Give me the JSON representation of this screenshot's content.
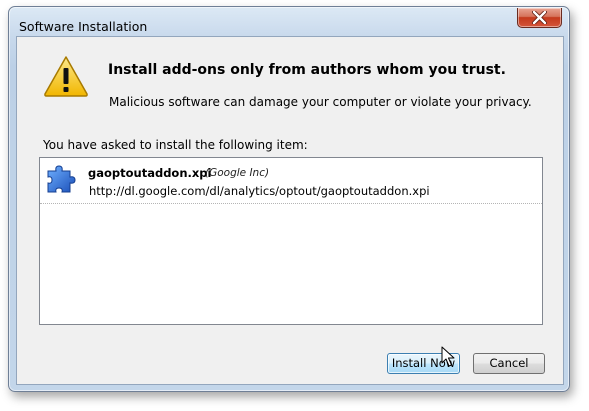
{
  "window": {
    "title": "Software Installation"
  },
  "warning": {
    "heading": "Install add-ons only from authors whom you trust.",
    "subtext": "Malicious software can damage your computer or violate your privacy."
  },
  "items_caption": "You have asked to install the following item:",
  "items": [
    {
      "name": "gaoptoutaddon.xpi",
      "author": "(Google Inc)",
      "url": "http://dl.google.com/dl/analytics/optout/gaoptoutaddon.xpi",
      "icon": "puzzle-piece-icon"
    }
  ],
  "buttons": {
    "install_label": "Install Now",
    "cancel_label": "Cancel"
  },
  "icons": {
    "warning": "warning-triangle-icon",
    "close": "close-icon",
    "cursor": "mouse-cursor-icon"
  },
  "colors": {
    "close_button": "#c4391c",
    "addon_icon": "#2f6fd4",
    "warning_icon": "#f5c518",
    "default_button_border": "#3c7fb1"
  }
}
